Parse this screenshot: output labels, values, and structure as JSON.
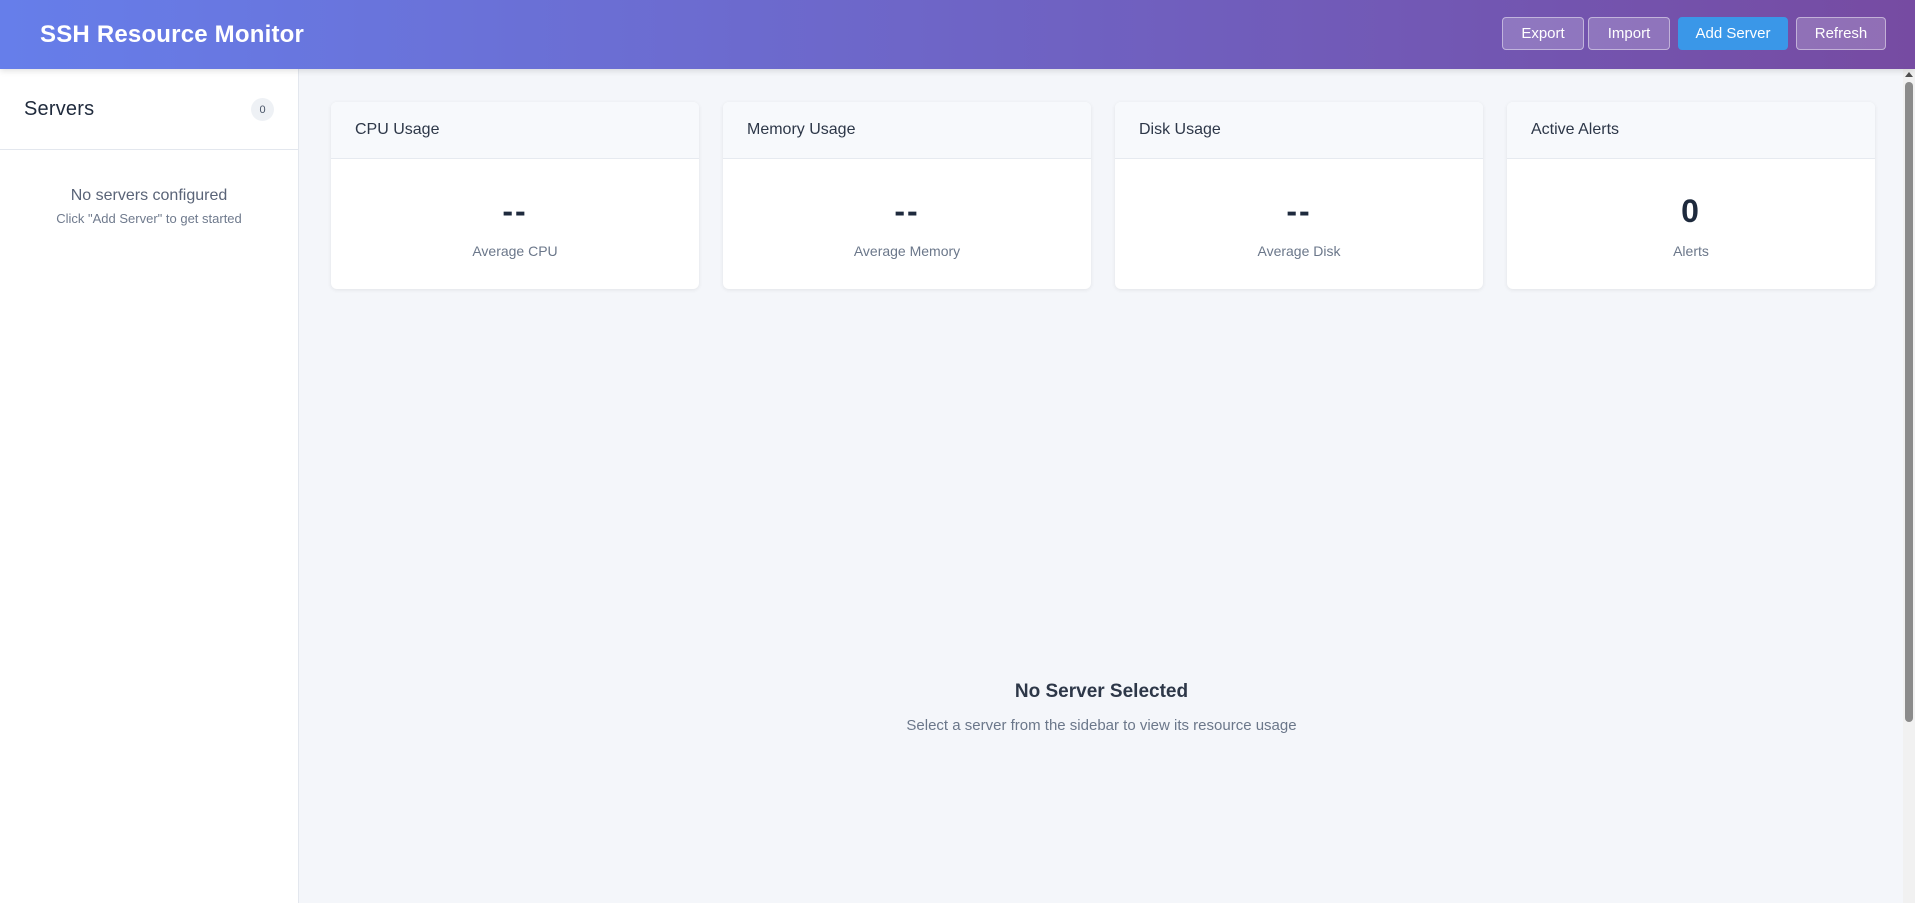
{
  "header": {
    "title": "SSH Resource Monitor",
    "export_label": "Export",
    "import_label": "Import",
    "add_label": "Add Server",
    "refresh_label": "Refresh"
  },
  "sidebar": {
    "title": "Servers",
    "count": "0",
    "empty_title": "No servers configured",
    "empty_hint": "Click \"Add Server\" to get started"
  },
  "cards": [
    {
      "title": "CPU Usage",
      "value": "--",
      "subtitle": "Average CPU"
    },
    {
      "title": "Memory Usage",
      "value": "--",
      "subtitle": "Average Memory"
    },
    {
      "title": "Disk Usage",
      "value": "--",
      "subtitle": "Average Disk"
    },
    {
      "title": "Active Alerts",
      "value": "0",
      "subtitle": "Alerts"
    }
  ],
  "placeholder": {
    "title": "No Server Selected",
    "subtitle": "Select a server from the sidebar to view its resource usage"
  },
  "colors": {
    "header_gradient_start": "#667eea",
    "header_gradient_end": "#764ba2",
    "primary_button": "#3a97e8"
  }
}
